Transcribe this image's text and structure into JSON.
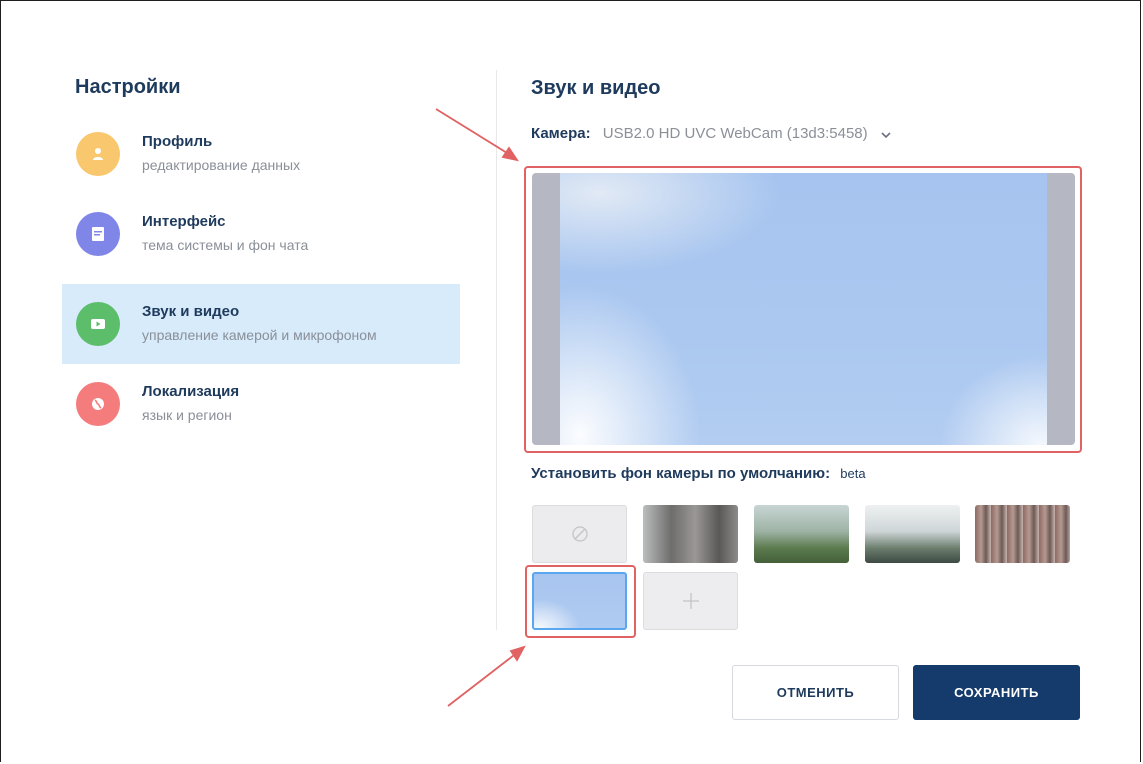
{
  "sidebar": {
    "title": "Настройки",
    "items": [
      {
        "title": "Профиль",
        "subtitle": "редактирование данных",
        "icon": "person-icon",
        "color": "#f9c86e"
      },
      {
        "title": "Интерфейс",
        "subtitle": "тема системы и фон чата",
        "icon": "document-icon",
        "color": "#7f86e8"
      },
      {
        "title": "Звук и видео",
        "subtitle": "управление камерой и микрофоном",
        "icon": "video-icon",
        "color": "#5cbe6a",
        "active": true
      },
      {
        "title": "Локализация",
        "subtitle": "язык и регион",
        "icon": "globe-icon",
        "color": "#f47c7c"
      }
    ]
  },
  "main": {
    "title": "Звук и видео",
    "camera_label": "Камера:",
    "camera_value": "USB2.0 HD UVC WebCam (13d3:5458)",
    "background_label": "Установить фон камеры по умолчанию:",
    "background_badge": "beta",
    "backgrounds": [
      "none",
      "blurred-room",
      "office-plants",
      "office-interior",
      "brick-wall",
      "blue-blur"
    ],
    "selected_background": "blue-blur"
  },
  "footer": {
    "cancel_label": "ОТМЕНИТЬ",
    "save_label": "СОХРАНИТЬ"
  },
  "colors": {
    "accent": "#143b6b",
    "highlight_border": "#e06262",
    "active_item_bg": "#d7ebfb"
  }
}
